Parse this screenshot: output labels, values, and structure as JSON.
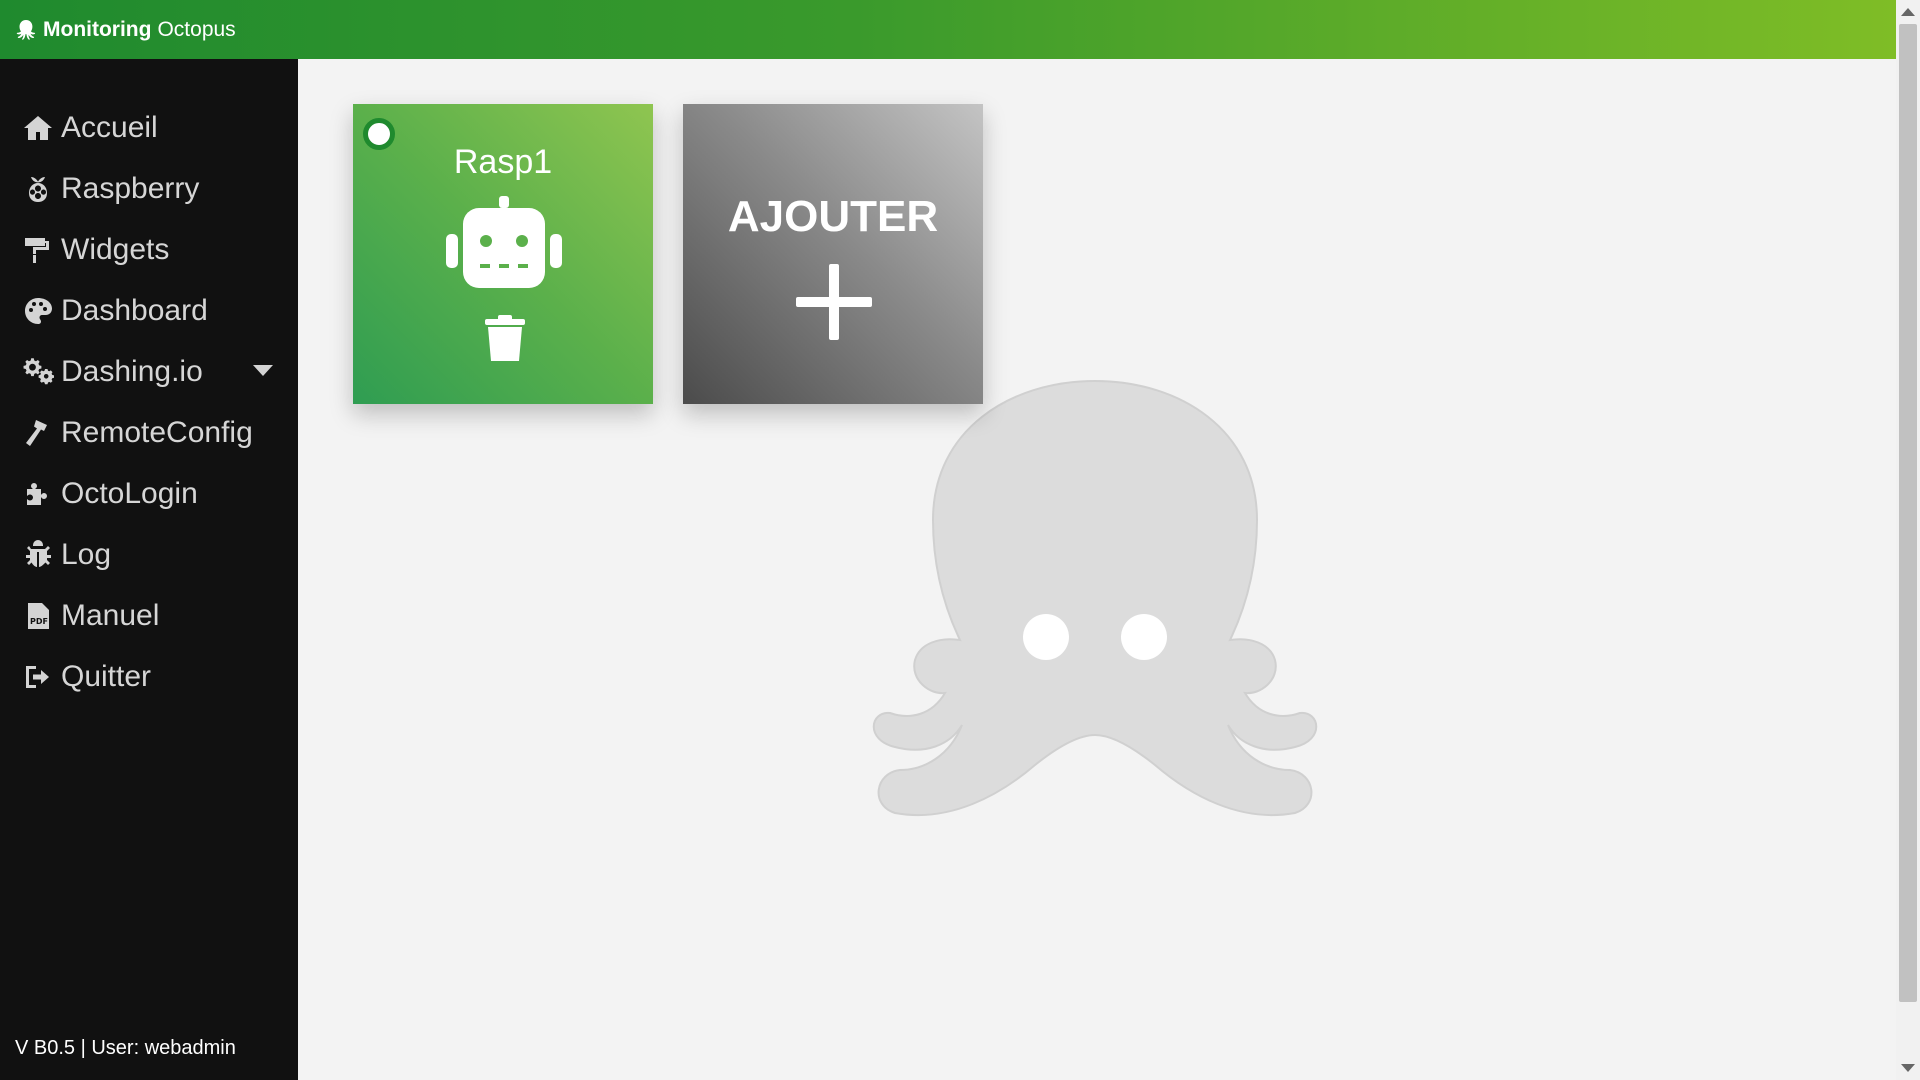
{
  "header": {
    "brand_bold": "Monitoring",
    "brand_light": "Octopus",
    "icon": "octopus-icon",
    "gradient": [
      "#1f8a2e",
      "#7fbd26"
    ]
  },
  "sidebar": {
    "background": "#111111",
    "items": [
      {
        "label": "Accueil",
        "icon": "home-icon"
      },
      {
        "label": "Raspberry",
        "icon": "raspberry-icon"
      },
      {
        "label": "Widgets",
        "icon": "paint-roller-icon"
      },
      {
        "label": "Dashboard",
        "icon": "palette-icon"
      },
      {
        "label": "Dashing.io",
        "icon": "cogs-icon",
        "has_dropdown": true
      },
      {
        "label": "RemoteConfig",
        "icon": "hammer-icon"
      },
      {
        "label": "OctoLogin",
        "icon": "puzzle-icon"
      },
      {
        "label": "Log",
        "icon": "bug-icon"
      },
      {
        "label": "Manuel",
        "icon": "file-pdf-icon"
      },
      {
        "label": "Quitter",
        "icon": "sign-out-icon"
      }
    ],
    "footer": "V B0.5 | User: webadmin"
  },
  "main": {
    "devices": [
      {
        "name": "Rasp1",
        "icon": "robot-icon",
        "status_color": "#1f8a2e"
      }
    ],
    "add_card": {
      "label": "AJOUTER",
      "icon": "plus-icon"
    },
    "background_logo": "octopus-logo"
  }
}
